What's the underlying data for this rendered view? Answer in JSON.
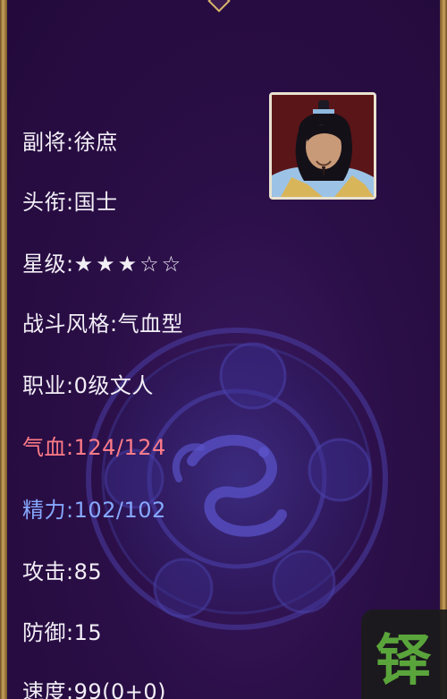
{
  "general": {
    "deputy": "副将:徐庶",
    "title": "头衔:国士",
    "star_label": "星级:",
    "stars_filled": 3,
    "stars_total": 5,
    "stars_text": "★★★☆☆",
    "battle_style": "战斗风格:气血型",
    "profession": "职业:0级文人",
    "hp_label": "气血:",
    "hp_value": "124/124",
    "mp_label": "精力:",
    "mp_value": "102/102",
    "attack": "攻击:85",
    "defense": "防御:15",
    "speed": "速度:99(0+0)"
  },
  "watermark": {
    "glyph": "铎"
  },
  "colors": {
    "background": "#2a0e46",
    "text": "#f2eef6",
    "hp": "#ff7b88",
    "mp": "#86a8ff",
    "frame": "#c9a25a",
    "watermark_glyph": "#5fb23b"
  },
  "icons": {
    "portrait": "general-portrait-icon",
    "emblem": "dragon-emblem-icon"
  }
}
